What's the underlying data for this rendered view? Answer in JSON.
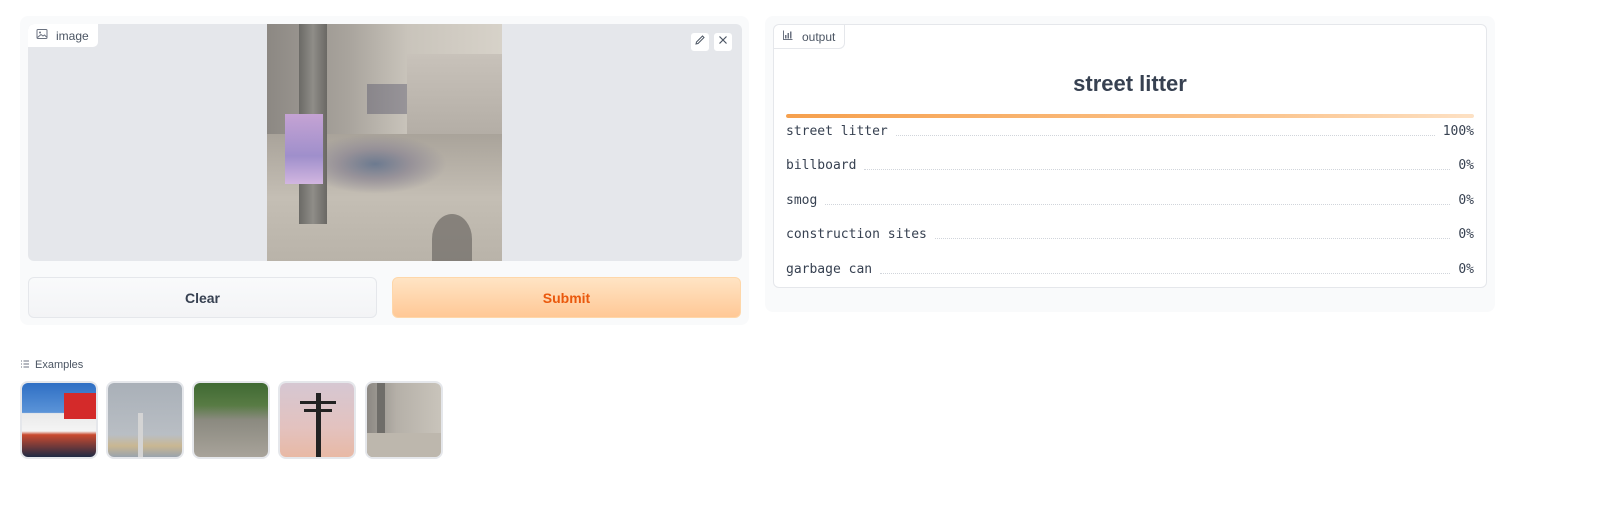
{
  "input": {
    "label": "image",
    "icons": {
      "label": "image-icon",
      "edit": "pencil-icon",
      "close": "close-icon"
    }
  },
  "buttons": {
    "clear": "Clear",
    "submit": "Submit"
  },
  "output": {
    "label": "output",
    "icon": "bar-chart-icon",
    "top_label": "street litter",
    "top_confidence": 1.0,
    "confidences": [
      {
        "label": "street litter",
        "value": "100%"
      },
      {
        "label": "billboard",
        "value": "0%"
      },
      {
        "label": "smog",
        "value": "0%"
      },
      {
        "label": "construction sites",
        "value": "0%"
      },
      {
        "label": "garbage can",
        "value": "0%"
      }
    ]
  },
  "examples": {
    "label": "Examples",
    "icon": "list-icon",
    "items": [
      "billboard-example",
      "smog-example",
      "street-litter-example",
      "power-pole-example",
      "street-wall-example"
    ]
  },
  "colors": {
    "accent": "#ea580c",
    "submit_bg": "#ffc896",
    "panel_bg": "#f9fafb"
  }
}
